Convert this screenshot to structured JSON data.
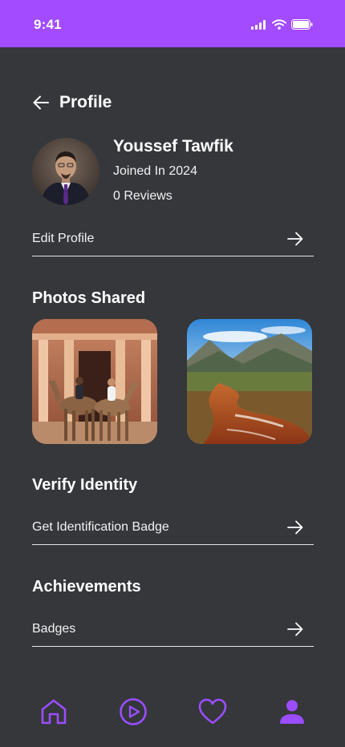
{
  "status_bar": {
    "time": "9:41",
    "background": "#A24BFF"
  },
  "header": {
    "title": "Profile",
    "back_icon": "arrow-left-icon"
  },
  "user": {
    "name": "Youssef Tawfik",
    "joined": "Joined In 2024",
    "reviews": "0 Reviews"
  },
  "edit_profile": {
    "label": "Edit Profile",
    "icon": "arrow-right-icon"
  },
  "photos": {
    "title": "Photos Shared",
    "items": [
      {
        "subject": "Camels in front of a carved rock facade"
      },
      {
        "subject": "Mountain valley with an orange stream"
      }
    ]
  },
  "verify": {
    "title": "Verify Identity",
    "item_label": "Get Identification Badge",
    "icon": "arrow-right-icon"
  },
  "achievements": {
    "title": "Achievements",
    "item_label": "Badges",
    "icon": "arrow-right-icon"
  },
  "bottom_nav": {
    "items": [
      "home-icon",
      "play-icon",
      "heart-icon",
      "profile-icon"
    ],
    "active": "profile-icon",
    "accent": "#9B4DFF"
  },
  "colors": {
    "background": "#35373B",
    "accent": "#A24BFF"
  }
}
